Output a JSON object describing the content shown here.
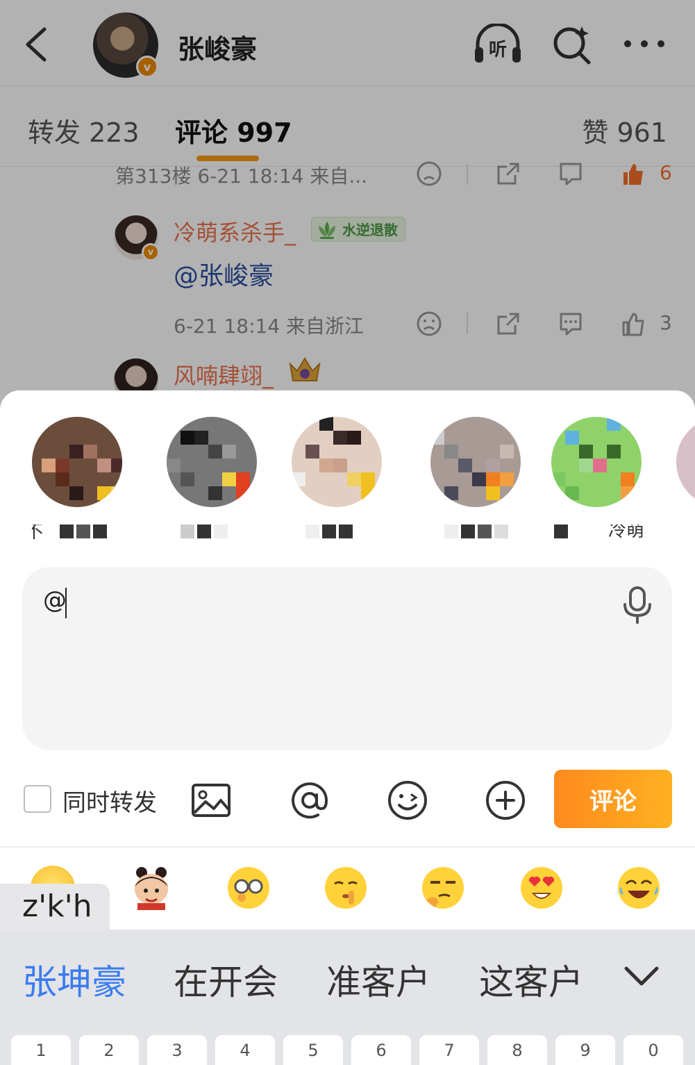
{
  "header": {
    "back_icon": "chevron-left-icon",
    "user_name": "张峻豪",
    "verified_badge": "v",
    "listen_label": "听",
    "search_icon": "search-sparkle-icon",
    "more_icon": "more-dots-icon"
  },
  "tabs": {
    "repost": "转发 223",
    "comment": "评论 997",
    "like": "赞 961"
  },
  "comments": {
    "partial_meta": "第313楼 6-21 18:14 来自...",
    "partial_like_count": "6",
    "reply": {
      "user_name": "冷萌系杀手_",
      "badge": "水逆退散",
      "text": "@张峻豪",
      "meta": "6-21 18:14 来自浙江",
      "like_count": "3"
    },
    "next_user_name": "风喃肆翊_"
  },
  "sheet": {
    "input_value": "@",
    "sync_repost_label": "同时转发",
    "submit_label": "评论",
    "contact_name_fragments": [
      "不",
      "冷萌"
    ]
  },
  "ime": {
    "composition": "z'k'h",
    "candidates": [
      "张坤豪",
      "在开会",
      "准客户",
      "这客户"
    ],
    "number_keys": [
      "1",
      "2",
      "3",
      "4",
      "5",
      "6",
      "7",
      "8",
      "9",
      "0"
    ]
  },
  "colors": {
    "accent": "#f79a14",
    "username": "#eb7350",
    "mention": "#2d4fa1",
    "candidate_active": "#3a7cf0"
  }
}
